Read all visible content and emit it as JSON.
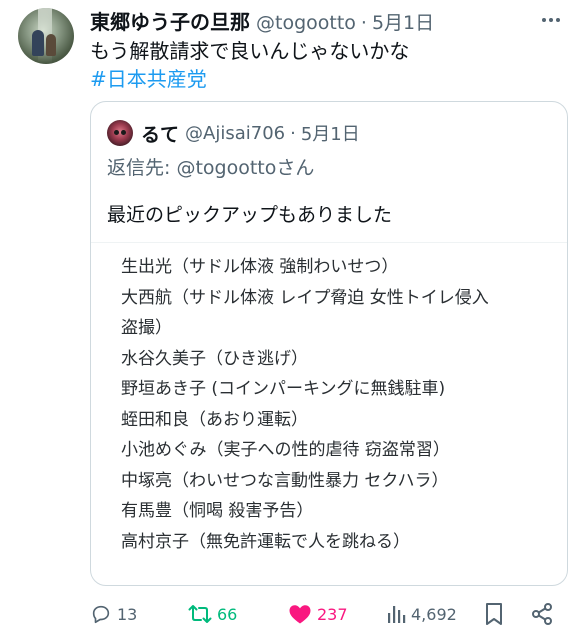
{
  "tweet": {
    "display_name": "東郷ゆう子の旦那",
    "handle": "@togootto",
    "separator": "·",
    "date": "5月1日",
    "more_icon": "more-icon",
    "text": "もう解散請求で良いんじゃないかな",
    "hashtag": "#日本共産党"
  },
  "quote": {
    "display_name": "るて",
    "handle": "@Ajisai706",
    "separator": "·",
    "date": "5月1日",
    "reply_prefix": "返信先: ",
    "reply_mention": "@togoottoさん",
    "text": "最近のピックアップもありました",
    "list": [
      "生出光（サドル体液 強制わいせつ）",
      "大西航（サドル体液 レイプ脅迫 女性トイレ侵入",
      "盗撮）",
      "水谷久美子（ひき逃げ）",
      "野垣あき子 (コインパーキングに無銭駐車)",
      "蛭田和良（あおり運転）",
      "小池めぐみ（実子への性的虐待 窃盗常習）",
      "中塚亮（わいせつな言動性暴力 セクハラ）",
      "有馬豊（恫喝 殺害予告）",
      "高村京子（無免許運転で人を跳ねる）"
    ]
  },
  "actions": {
    "replies": "13",
    "retweets": "66",
    "likes": "237",
    "views": "4,692"
  },
  "colors": {
    "link": "#1d9bf0",
    "retweet": "#00ba7c",
    "like": "#f91880",
    "secondary": "#536471"
  }
}
